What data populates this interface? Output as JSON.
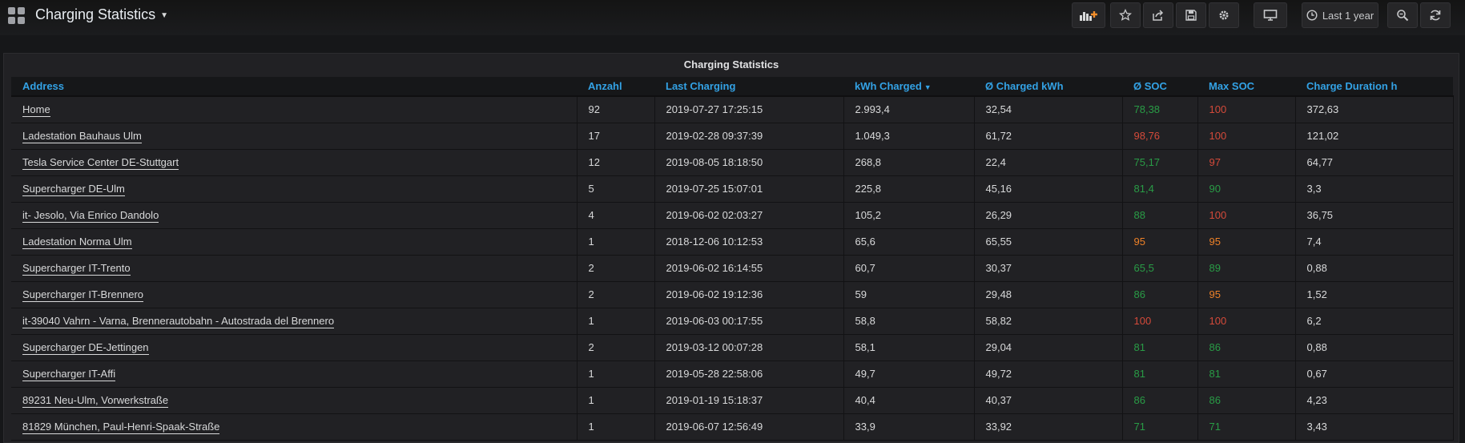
{
  "dashboard": {
    "title": "Charging Statistics"
  },
  "toolbar": {
    "time_range_label": "Last 1 year"
  },
  "panel": {
    "title": "Charging Statistics"
  },
  "colors": {
    "good": "#299c46",
    "warn": "#ed8128",
    "bad": "#d44a3a",
    "header": "#33a2e5"
  },
  "table": {
    "columns": [
      {
        "label": "Address"
      },
      {
        "label": "Anzahl"
      },
      {
        "label": "Last Charging"
      },
      {
        "label": "kWh Charged"
      },
      {
        "label": "Ø Charged kWh"
      },
      {
        "label": "Ø SOC"
      },
      {
        "label": "Max SOC"
      },
      {
        "label": "Charge Duration h"
      }
    ],
    "rows": [
      {
        "address": "Home",
        "anzahl": "92",
        "last": "2019-07-27 17:25:15",
        "kwh": "2.993,4",
        "avg_kwh": "32,54",
        "avg_soc": "78,38",
        "avg_soc_color": "green",
        "max_soc": "100",
        "max_soc_color": "red",
        "duration": "372,63"
      },
      {
        "address": "Ladestation Bauhaus Ulm",
        "anzahl": "17",
        "last": "2019-02-28 09:37:39",
        "kwh": "1.049,3",
        "avg_kwh": "61,72",
        "avg_soc": "98,76",
        "avg_soc_color": "red",
        "max_soc": "100",
        "max_soc_color": "red",
        "duration": "121,02"
      },
      {
        "address": "Tesla Service Center DE-Stuttgart",
        "anzahl": "12",
        "last": "2019-08-05 18:18:50",
        "kwh": "268,8",
        "avg_kwh": "22,4",
        "avg_soc": "75,17",
        "avg_soc_color": "green",
        "max_soc": "97",
        "max_soc_color": "red",
        "duration": "64,77"
      },
      {
        "address": "Supercharger DE-Ulm",
        "anzahl": "5",
        "last": "2019-07-25 15:07:01",
        "kwh": "225,8",
        "avg_kwh": "45,16",
        "avg_soc": "81,4",
        "avg_soc_color": "green",
        "max_soc": "90",
        "max_soc_color": "green",
        "duration": "3,3"
      },
      {
        "address": "it- Jesolo, Via Enrico Dandolo",
        "anzahl": "4",
        "last": "2019-06-02 02:03:27",
        "kwh": "105,2",
        "avg_kwh": "26,29",
        "avg_soc": "88",
        "avg_soc_color": "green",
        "max_soc": "100",
        "max_soc_color": "red",
        "duration": "36,75"
      },
      {
        "address": "Ladestation Norma Ulm",
        "anzahl": "1",
        "last": "2018-12-06 10:12:53",
        "kwh": "65,6",
        "avg_kwh": "65,55",
        "avg_soc": "95",
        "avg_soc_color": "orange",
        "max_soc": "95",
        "max_soc_color": "orange",
        "duration": "7,4"
      },
      {
        "address": "Supercharger IT-Trento",
        "anzahl": "2",
        "last": "2019-06-02 16:14:55",
        "kwh": "60,7",
        "avg_kwh": "30,37",
        "avg_soc": "65,5",
        "avg_soc_color": "green",
        "max_soc": "89",
        "max_soc_color": "green",
        "duration": "0,88"
      },
      {
        "address": "Supercharger IT-Brennero",
        "anzahl": "2",
        "last": "2019-06-02 19:12:36",
        "kwh": "59",
        "avg_kwh": "29,48",
        "avg_soc": "86",
        "avg_soc_color": "green",
        "max_soc": "95",
        "max_soc_color": "orange",
        "duration": "1,52"
      },
      {
        "address": "it-39040 Vahrn - Varna, Brennerautobahn - Autostrada del Brennero",
        "anzahl": "1",
        "last": "2019-06-03 00:17:55",
        "kwh": "58,8",
        "avg_kwh": "58,82",
        "avg_soc": "100",
        "avg_soc_color": "red",
        "max_soc": "100",
        "max_soc_color": "red",
        "duration": "6,2"
      },
      {
        "address": "Supercharger DE-Jettingen",
        "anzahl": "2",
        "last": "2019-03-12 00:07:28",
        "kwh": "58,1",
        "avg_kwh": "29,04",
        "avg_soc": "81",
        "avg_soc_color": "green",
        "max_soc": "86",
        "max_soc_color": "green",
        "duration": "0,88"
      },
      {
        "address": "Supercharger IT-Affi",
        "anzahl": "1",
        "last": "2019-05-28 22:58:06",
        "kwh": "49,7",
        "avg_kwh": "49,72",
        "avg_soc": "81",
        "avg_soc_color": "green",
        "max_soc": "81",
        "max_soc_color": "green",
        "duration": "0,67"
      },
      {
        "address": "89231 Neu-Ulm, Vorwerkstraße",
        "anzahl": "1",
        "last": "2019-01-19 15:18:37",
        "kwh": "40,4",
        "avg_kwh": "40,37",
        "avg_soc": "86",
        "avg_soc_color": "green",
        "max_soc": "86",
        "max_soc_color": "green",
        "duration": "4,23"
      },
      {
        "address": "81829 München, Paul-Henri-Spaak-Straße",
        "anzahl": "1",
        "last": "2019-06-07 12:56:49",
        "kwh": "33,9",
        "avg_kwh": "33,92",
        "avg_soc": "71",
        "avg_soc_color": "green",
        "max_soc": "71",
        "max_soc_color": "green",
        "duration": "3,43"
      }
    ]
  }
}
